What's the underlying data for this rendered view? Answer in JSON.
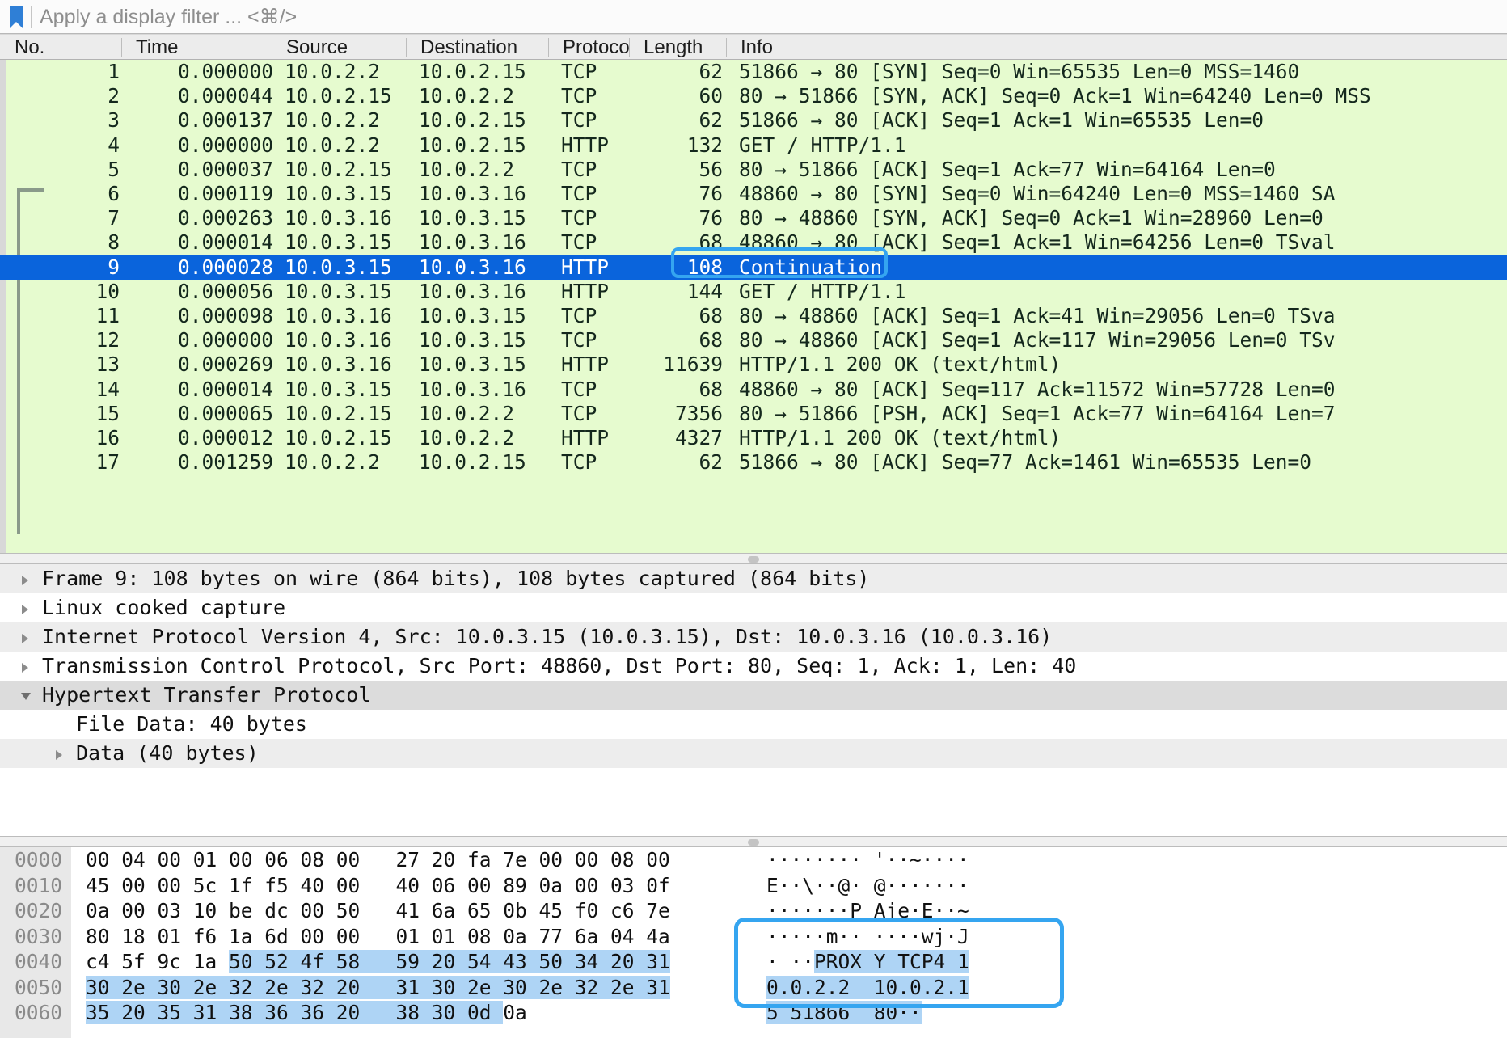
{
  "filter_bar": {
    "icon": "bookmark-icon",
    "placeholder": "Apply a display filter ... <⌘/>",
    "value": ""
  },
  "columns": [
    {
      "key": "num",
      "label": "No."
    },
    {
      "key": "time",
      "label": "Time"
    },
    {
      "key": "src",
      "label": "Source"
    },
    {
      "key": "dst",
      "label": "Destination"
    },
    {
      "key": "proto",
      "label": "Protocol"
    },
    {
      "key": "len",
      "label": "Length"
    },
    {
      "key": "info",
      "label": "Info"
    }
  ],
  "packets": [
    {
      "num": "1",
      "time": "0.000000",
      "src": "10.0.2.2",
      "dst": "10.0.2.15",
      "proto": "TCP",
      "len": "62",
      "info": "51866 → 80 [SYN] Seq=0 Win=65535 Len=0 MSS=1460",
      "selected": false
    },
    {
      "num": "2",
      "time": "0.000044",
      "src": "10.0.2.15",
      "dst": "10.0.2.2",
      "proto": "TCP",
      "len": "60",
      "info": "80 → 51866 [SYN, ACK] Seq=0 Ack=1 Win=64240 Len=0 MSS",
      "selected": false
    },
    {
      "num": "3",
      "time": "0.000137",
      "src": "10.0.2.2",
      "dst": "10.0.2.15",
      "proto": "TCP",
      "len": "62",
      "info": "51866 → 80 [ACK] Seq=1 Ack=1 Win=65535 Len=0",
      "selected": false
    },
    {
      "num": "4",
      "time": "0.000000",
      "src": "10.0.2.2",
      "dst": "10.0.2.15",
      "proto": "HTTP",
      "len": "132",
      "info": "GET / HTTP/1.1",
      "selected": false
    },
    {
      "num": "5",
      "time": "0.000037",
      "src": "10.0.2.15",
      "dst": "10.0.2.2",
      "proto": "TCP",
      "len": "56",
      "info": "80 → 51866 [ACK] Seq=1 Ack=77 Win=64164 Len=0",
      "selected": false
    },
    {
      "num": "6",
      "time": "0.000119",
      "src": "10.0.3.15",
      "dst": "10.0.3.16",
      "proto": "TCP",
      "len": "76",
      "info": "48860 → 80 [SYN] Seq=0 Win=64240 Len=0 MSS=1460 SA",
      "selected": false
    },
    {
      "num": "7",
      "time": "0.000263",
      "src": "10.0.3.16",
      "dst": "10.0.3.15",
      "proto": "TCP",
      "len": "76",
      "info": "80 → 48860 [SYN, ACK] Seq=0 Ack=1 Win=28960 Len=0 ",
      "selected": false
    },
    {
      "num": "8",
      "time": "0.000014",
      "src": "10.0.3.15",
      "dst": "10.0.3.16",
      "proto": "TCP",
      "len": "68",
      "info": "48860 → 80 [ACK] Seq=1 Ack=1 Win=64256 Len=0 TSval",
      "selected": false
    },
    {
      "num": "9",
      "time": "0.000028",
      "src": "10.0.3.15",
      "dst": "10.0.3.16",
      "proto": "HTTP",
      "len": "108",
      "info": "Continuation",
      "selected": true
    },
    {
      "num": "10",
      "time": "0.000056",
      "src": "10.0.3.15",
      "dst": "10.0.3.16",
      "proto": "HTTP",
      "len": "144",
      "info": "GET / HTTP/1.1",
      "selected": false
    },
    {
      "num": "11",
      "time": "0.000098",
      "src": "10.0.3.16",
      "dst": "10.0.3.15",
      "proto": "TCP",
      "len": "68",
      "info": "80 → 48860 [ACK] Seq=1 Ack=41 Win=29056 Len=0 TSva",
      "selected": false
    },
    {
      "num": "12",
      "time": "0.000000",
      "src": "10.0.3.16",
      "dst": "10.0.3.15",
      "proto": "TCP",
      "len": "68",
      "info": "80 → 48860 [ACK] Seq=1 Ack=117 Win=29056 Len=0 TSv",
      "selected": false
    },
    {
      "num": "13",
      "time": "0.000269",
      "src": "10.0.3.16",
      "dst": "10.0.3.15",
      "proto": "HTTP",
      "len": "11639",
      "info": "HTTP/1.1 200 OK  (text/html)",
      "selected": false
    },
    {
      "num": "14",
      "time": "0.000014",
      "src": "10.0.3.15",
      "dst": "10.0.3.16",
      "proto": "TCP",
      "len": "68",
      "info": "48860 → 80 [ACK] Seq=117 Ack=11572 Win=57728 Len=0",
      "selected": false
    },
    {
      "num": "15",
      "time": "0.000065",
      "src": "10.0.2.15",
      "dst": "10.0.2.2",
      "proto": "TCP",
      "len": "7356",
      "info": "80 → 51866 [PSH, ACK] Seq=1 Ack=77 Win=64164 Len=7",
      "selected": false
    },
    {
      "num": "16",
      "time": "0.000012",
      "src": "10.0.2.15",
      "dst": "10.0.2.2",
      "proto": "HTTP",
      "len": "4327",
      "info": "HTTP/1.1 200 OK  (text/html)",
      "selected": false
    },
    {
      "num": "17",
      "time": "0.001259",
      "src": "10.0.2.2",
      "dst": "10.0.2.15",
      "proto": "TCP",
      "len": "62",
      "info": "51866 → 80 [ACK] Seq=77 Ack=1461 Win=65535 Len=0",
      "selected": false
    }
  ],
  "detail_tree": [
    {
      "label": "Frame 9: 108 bytes on wire (864 bits), 108 bytes captured (864 bits)",
      "indent": 0,
      "twisty": "collapsed",
      "shade": "shade0"
    },
    {
      "label": "Linux cooked capture",
      "indent": 0,
      "twisty": "collapsed",
      "shade": "shade1"
    },
    {
      "label": "Internet Protocol Version 4, Src: 10.0.3.15 (10.0.3.15), Dst: 10.0.3.16 (10.0.3.16)",
      "indent": 0,
      "twisty": "collapsed",
      "shade": "shade0"
    },
    {
      "label": "Transmission Control Protocol, Src Port: 48860, Dst Port: 80, Seq: 1, Ack: 1, Len: 40",
      "indent": 0,
      "twisty": "collapsed",
      "shade": "shade1"
    },
    {
      "label": "Hypertext Transfer Protocol",
      "indent": 0,
      "twisty": "expanded",
      "shade": "shade2"
    },
    {
      "label": "File Data: 40 bytes",
      "indent": 1,
      "twisty": "none",
      "shade": "shade1"
    },
    {
      "label": "Data (40 bytes)",
      "indent": 1,
      "twisty": "collapsed",
      "shade": "shade0"
    }
  ],
  "hex_dump": [
    {
      "offset": "0000",
      "bytes": "00 04 00 01 00 06 08 00   27 20 fa 7e 00 00 08 00",
      "ascii": "········ '··~····",
      "hl_hex_start": -1,
      "hl_hex_end": -1,
      "hl_ascii_start": -1,
      "hl_ascii_end": -1
    },
    {
      "offset": "0010",
      "bytes": "45 00 00 5c 1f f5 40 00   40 06 00 89 0a 00 03 0f",
      "ascii": "E··\\··@· @·······",
      "hl_hex_start": -1,
      "hl_hex_end": -1,
      "hl_ascii_start": -1,
      "hl_ascii_end": -1
    },
    {
      "offset": "0020",
      "bytes": "0a 00 03 10 be dc 00 50   41 6a 65 0b 45 f0 c6 7e",
      "ascii": "·······P Aje·E··~",
      "hl_hex_start": -1,
      "hl_hex_end": -1,
      "hl_ascii_start": -1,
      "hl_ascii_end": -1
    },
    {
      "offset": "0030",
      "bytes": "80 18 01 f6 1a 6d 00 00   01 01 08 0a 77 6a 04 4a",
      "ascii": "·····m·· ····wj·J",
      "hl_hex_start": -1,
      "hl_hex_end": -1,
      "hl_ascii_start": -1,
      "hl_ascii_end": -1
    },
    {
      "offset": "0040",
      "bytes": "c4 5f 9c 1a 50 52 4f 58   59 20 54 43 50 34 20 31",
      "ascii": "·_··PROX Y TCP4 1",
      "hl_hex_start": 12,
      "hl_hex_end": 49,
      "hl_ascii_start": 4,
      "hl_ascii_end": 17
    },
    {
      "offset": "0050",
      "bytes": "30 2e 30 2e 32 2e 32 20   31 30 2e 30 2e 32 2e 31",
      "ascii": "0.0.2.2  10.0.2.1",
      "hl_hex_start": 0,
      "hl_hex_end": 49,
      "hl_ascii_start": 0,
      "hl_ascii_end": 17
    },
    {
      "offset": "0060",
      "bytes": "35 20 35 31 38 36 36 20   38 30 0d 0a",
      "ascii": "5 51866  80··",
      "hl_hex_start": 0,
      "hl_hex_end": 35,
      "hl_ascii_start": 0,
      "hl_ascii_end": 13
    }
  ],
  "annotations": {
    "color": "#35a5f0",
    "info_cell": "Continuation",
    "ascii_block": "PROXY TCP4 10.0.2.2 10.0.2.15 51866 80"
  },
  "colors": {
    "packet_row_bg": "#e6fbcf",
    "selected_row_bg": "#0a64dc",
    "hex_highlight": "#aed4f5",
    "annotation": "#35a5f0"
  }
}
